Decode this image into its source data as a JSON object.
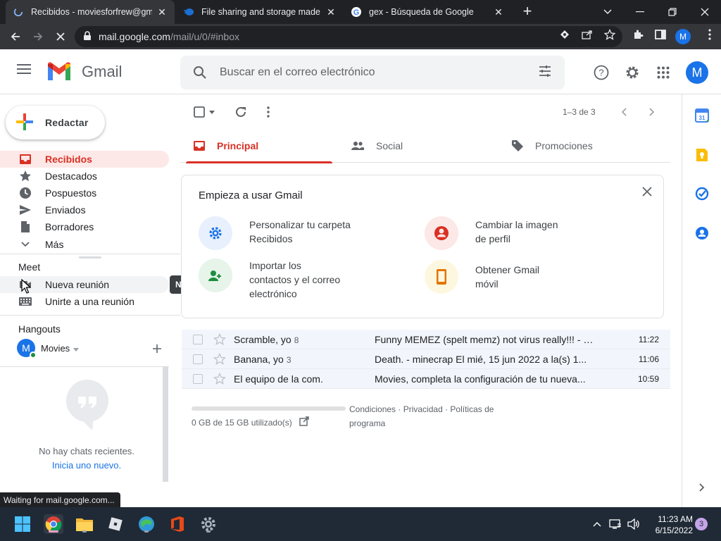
{
  "browser": {
    "tabs": [
      {
        "title": "Recibidos - moviesforfrew@gmail.com",
        "active": true
      },
      {
        "title": "File sharing and storage made simple",
        "active": false
      },
      {
        "title": "gex - Búsqueda de Google",
        "active": false
      }
    ],
    "url_host": "mail.google.com",
    "url_path": "/mail/u/0/#inbox",
    "profile_initial": "M"
  },
  "gmail": {
    "product_name": "Gmail",
    "search_placeholder": "Buscar en el correo electrónico",
    "account_initial": "M",
    "compose_label": "Redactar",
    "nav": [
      {
        "label": "Recibidos",
        "icon": "inbox-icon",
        "active": true
      },
      {
        "label": "Destacados",
        "icon": "star-icon"
      },
      {
        "label": "Pospuestos",
        "icon": "clock-icon"
      },
      {
        "label": "Enviados",
        "icon": "send-icon"
      },
      {
        "label": "Borradores",
        "icon": "draft-icon"
      },
      {
        "label": "Más",
        "icon": "chevron-down-icon"
      }
    ],
    "meet": {
      "title": "Meet",
      "items": [
        {
          "label": "Nueva reunión",
          "icon": "video-icon"
        },
        {
          "label": "Unirte a una reunión",
          "icon": "keyboard-icon"
        }
      ],
      "tooltip": "Nueva reunión"
    },
    "hangouts": {
      "title": "Hangouts",
      "user_initial": "M",
      "user_name": "Movies",
      "empty_text": "No hay chats recientes.",
      "start_link": "Inicia uno nuevo."
    },
    "pager": "1–3 de 3",
    "category_tabs": [
      {
        "label": "Principal",
        "active": true
      },
      {
        "label": "Social"
      },
      {
        "label": "Promociones"
      }
    ],
    "get_started": {
      "title": "Empieza a usar Gmail",
      "items": [
        {
          "text": "Personalizar tu carpeta Recibidos",
          "icon": "gear-icon"
        },
        {
          "text": "Cambiar la imagen de perfil",
          "icon": "account-icon"
        },
        {
          "text": "Importar los contactos y el correo electrónico",
          "icon": "import-contacts-icon"
        },
        {
          "text": "Obtener Gmail móvil",
          "icon": "phone-icon"
        }
      ]
    },
    "emails": [
      {
        "sender": "Scramble, yo",
        "count": "8",
        "subject": "Funny MEMEZ (spelt memz) not virus really!!! - h...",
        "time": "11:22"
      },
      {
        "sender": "Banana, yo",
        "count": "3",
        "subject": "Death. - minecrap El mié, 15 jun 2022 a la(s) 1...",
        "time": "11:06"
      },
      {
        "sender": "El equipo de la com.",
        "count": "",
        "subject": "Movies, completa la configuración de tu nueva...",
        "time": "10:59"
      }
    ],
    "storage_text": "0 GB de 15 GB utilizado(s)",
    "storage_used_fraction": 0,
    "footer_links": [
      "Condiciones",
      "Privacidad",
      "Políticas de programa"
    ]
  },
  "status_bubble": "Waiting for mail.google.com...",
  "taskbar": {
    "time": "11:23 AM",
    "date": "6/15/2022",
    "notifications": "3"
  },
  "colors": {
    "accent_red": "#d93025",
    "active_bg": "#fce8e6",
    "link_blue": "#1a73e8",
    "chrome_dark": "#202124"
  }
}
